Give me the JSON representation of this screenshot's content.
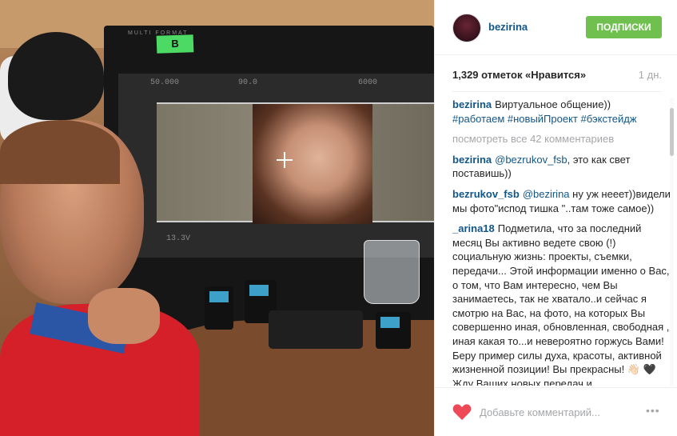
{
  "photo": {
    "monitor_brand": "MULTI FORMAT",
    "tape_label": "B",
    "readout_left": "50.000",
    "readout_mid": "90.0",
    "readout_right": "6000",
    "bottom_readout": "13.3V"
  },
  "header": {
    "username": "bezirina",
    "follow_label": "ПОДПИСКИ"
  },
  "likes": {
    "count": "1,329 отметок «Нравится»",
    "time": "1 дн."
  },
  "caption": {
    "user": "bezirina",
    "text": "Виртуальное общение))",
    "tags": "#работаем #новыйПроект #бэкстейдж"
  },
  "view_all": "посмотреть все 42 комментариев",
  "comments": [
    {
      "user": "bezirina",
      "mention": "@bezrukov_fsb",
      "text": ", это как свет поставишь))"
    },
    {
      "user": "bezrukov_fsb",
      "mention": "@bezirina",
      "text": " ну уж нееет))видели мы фото\"испод тишка \"..там тоже самое))"
    },
    {
      "user": "_arina18",
      "mention": "",
      "text": "Подметила, что за последний месяц Вы активно ведете свою (!) социальную жизнь: проекты, съемки, передачи... Этой информации именно о Вас, о том, что Вам интересно, чем Вы занимаетесь, так не хватало..и сейчас я смотрю на Вас, на фото, на которых Вы совершенно иная, обновленная, свободная , иная какая то...и невероятно горжусь Вами! Беру пример силы духа, красоты, активной жизненной позиции! Вы прекрасны! 👋🏻 🖤 Жду Ваших новых передач и"
    }
  ],
  "footer": {
    "placeholder": "Добавьте комментарий...",
    "more_label": "•••",
    "heart_color": "#ed4956"
  }
}
